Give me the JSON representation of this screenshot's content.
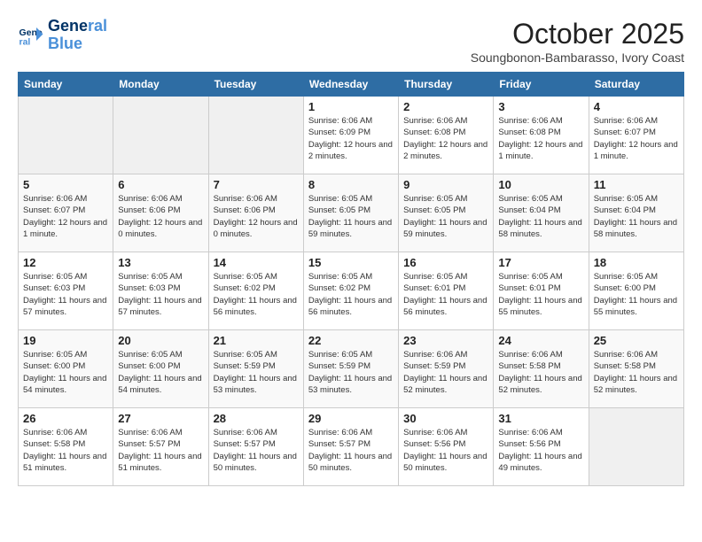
{
  "logo": {
    "line1": "General",
    "line2": "Blue"
  },
  "title": "October 2025",
  "subtitle": "Soungbonon-Bambarasso, Ivory Coast",
  "header": {
    "days": [
      "Sunday",
      "Monday",
      "Tuesday",
      "Wednesday",
      "Thursday",
      "Friday",
      "Saturday"
    ]
  },
  "weeks": [
    [
      {
        "day": "",
        "info": ""
      },
      {
        "day": "",
        "info": ""
      },
      {
        "day": "",
        "info": ""
      },
      {
        "day": "1",
        "info": "Sunrise: 6:06 AM\nSunset: 6:09 PM\nDaylight: 12 hours and 2 minutes."
      },
      {
        "day": "2",
        "info": "Sunrise: 6:06 AM\nSunset: 6:08 PM\nDaylight: 12 hours and 2 minutes."
      },
      {
        "day": "3",
        "info": "Sunrise: 6:06 AM\nSunset: 6:08 PM\nDaylight: 12 hours and 1 minute."
      },
      {
        "day": "4",
        "info": "Sunrise: 6:06 AM\nSunset: 6:07 PM\nDaylight: 12 hours and 1 minute."
      }
    ],
    [
      {
        "day": "5",
        "info": "Sunrise: 6:06 AM\nSunset: 6:07 PM\nDaylight: 12 hours and 1 minute."
      },
      {
        "day": "6",
        "info": "Sunrise: 6:06 AM\nSunset: 6:06 PM\nDaylight: 12 hours and 0 minutes."
      },
      {
        "day": "7",
        "info": "Sunrise: 6:06 AM\nSunset: 6:06 PM\nDaylight: 12 hours and 0 minutes."
      },
      {
        "day": "8",
        "info": "Sunrise: 6:05 AM\nSunset: 6:05 PM\nDaylight: 11 hours and 59 minutes."
      },
      {
        "day": "9",
        "info": "Sunrise: 6:05 AM\nSunset: 6:05 PM\nDaylight: 11 hours and 59 minutes."
      },
      {
        "day": "10",
        "info": "Sunrise: 6:05 AM\nSunset: 6:04 PM\nDaylight: 11 hours and 58 minutes."
      },
      {
        "day": "11",
        "info": "Sunrise: 6:05 AM\nSunset: 6:04 PM\nDaylight: 11 hours and 58 minutes."
      }
    ],
    [
      {
        "day": "12",
        "info": "Sunrise: 6:05 AM\nSunset: 6:03 PM\nDaylight: 11 hours and 57 minutes."
      },
      {
        "day": "13",
        "info": "Sunrise: 6:05 AM\nSunset: 6:03 PM\nDaylight: 11 hours and 57 minutes."
      },
      {
        "day": "14",
        "info": "Sunrise: 6:05 AM\nSunset: 6:02 PM\nDaylight: 11 hours and 56 minutes."
      },
      {
        "day": "15",
        "info": "Sunrise: 6:05 AM\nSunset: 6:02 PM\nDaylight: 11 hours and 56 minutes."
      },
      {
        "day": "16",
        "info": "Sunrise: 6:05 AM\nSunset: 6:01 PM\nDaylight: 11 hours and 56 minutes."
      },
      {
        "day": "17",
        "info": "Sunrise: 6:05 AM\nSunset: 6:01 PM\nDaylight: 11 hours and 55 minutes."
      },
      {
        "day": "18",
        "info": "Sunrise: 6:05 AM\nSunset: 6:00 PM\nDaylight: 11 hours and 55 minutes."
      }
    ],
    [
      {
        "day": "19",
        "info": "Sunrise: 6:05 AM\nSunset: 6:00 PM\nDaylight: 11 hours and 54 minutes."
      },
      {
        "day": "20",
        "info": "Sunrise: 6:05 AM\nSunset: 6:00 PM\nDaylight: 11 hours and 54 minutes."
      },
      {
        "day": "21",
        "info": "Sunrise: 6:05 AM\nSunset: 5:59 PM\nDaylight: 11 hours and 53 minutes."
      },
      {
        "day": "22",
        "info": "Sunrise: 6:05 AM\nSunset: 5:59 PM\nDaylight: 11 hours and 53 minutes."
      },
      {
        "day": "23",
        "info": "Sunrise: 6:06 AM\nSunset: 5:59 PM\nDaylight: 11 hours and 52 minutes."
      },
      {
        "day": "24",
        "info": "Sunrise: 6:06 AM\nSunset: 5:58 PM\nDaylight: 11 hours and 52 minutes."
      },
      {
        "day": "25",
        "info": "Sunrise: 6:06 AM\nSunset: 5:58 PM\nDaylight: 11 hours and 52 minutes."
      }
    ],
    [
      {
        "day": "26",
        "info": "Sunrise: 6:06 AM\nSunset: 5:58 PM\nDaylight: 11 hours and 51 minutes."
      },
      {
        "day": "27",
        "info": "Sunrise: 6:06 AM\nSunset: 5:57 PM\nDaylight: 11 hours and 51 minutes."
      },
      {
        "day": "28",
        "info": "Sunrise: 6:06 AM\nSunset: 5:57 PM\nDaylight: 11 hours and 50 minutes."
      },
      {
        "day": "29",
        "info": "Sunrise: 6:06 AM\nSunset: 5:57 PM\nDaylight: 11 hours and 50 minutes."
      },
      {
        "day": "30",
        "info": "Sunrise: 6:06 AM\nSunset: 5:56 PM\nDaylight: 11 hours and 50 minutes."
      },
      {
        "day": "31",
        "info": "Sunrise: 6:06 AM\nSunset: 5:56 PM\nDaylight: 11 hours and 49 minutes."
      },
      {
        "day": "",
        "info": ""
      }
    ]
  ]
}
